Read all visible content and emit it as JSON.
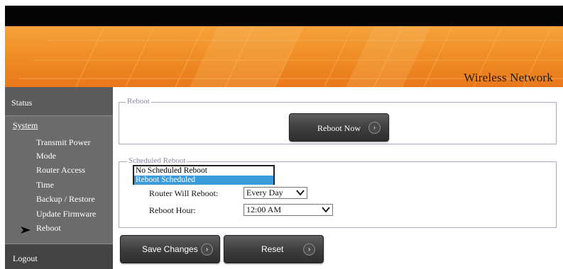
{
  "header": {
    "title": "Wireless Network"
  },
  "sidebar": {
    "status_label": "Status",
    "system_label": "System",
    "items": [
      {
        "label": "Transmit Power"
      },
      {
        "label": "Mode"
      },
      {
        "label": "Router Access"
      },
      {
        "label": "Time"
      },
      {
        "label": "Backup / Restore"
      },
      {
        "label": "Update Firmware"
      },
      {
        "label": "Reboot",
        "active": true
      }
    ],
    "logout_label": "Logout"
  },
  "reboot_section": {
    "legend": "Reboot",
    "reboot_now_label": "Reboot Now"
  },
  "scheduled_section": {
    "legend": "Scheduled Reboot",
    "dropdown_options": [
      "No Scheduled Reboot",
      "Reboot Scheduled"
    ],
    "dropdown_selected": "Reboot Scheduled",
    "router_will_reboot_label": "Router Will Reboot:",
    "router_will_reboot_value": "Every Day",
    "reboot_hour_label": "Reboot Hour:",
    "reboot_hour_value": "12:00 AM"
  },
  "actions": {
    "save_label": "Save Changes",
    "reset_label": "Reset"
  },
  "colors": {
    "banner_orange": "#f08f26",
    "sidebar_gray": "#6d6d6d",
    "selected_option_blue": "#3b9cd9"
  }
}
